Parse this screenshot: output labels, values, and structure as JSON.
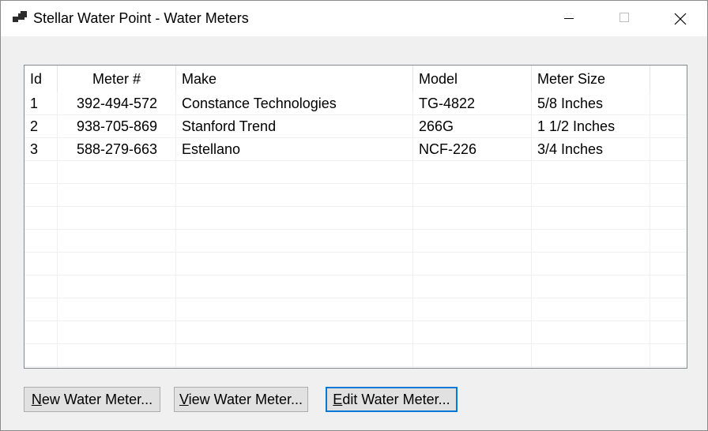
{
  "window": {
    "title": "Stellar Water Point - Water Meters",
    "icon": "app-window-icon"
  },
  "listview": {
    "columns": [
      {
        "key": "id",
        "label": "Id"
      },
      {
        "key": "meter",
        "label": "Meter #"
      },
      {
        "key": "make",
        "label": "Make"
      },
      {
        "key": "model",
        "label": "Model"
      },
      {
        "key": "size",
        "label": "Meter Size"
      }
    ],
    "rows": [
      {
        "id": "1",
        "meter": "392-494-572",
        "make": "Constance Technologies",
        "model": "TG-4822",
        "size": "5/8 Inches"
      },
      {
        "id": "2",
        "meter": "938-705-869",
        "make": "Stanford Trend",
        "model": "266G",
        "size": "1 1/2 Inches"
      },
      {
        "id": "3",
        "meter": "588-279-663",
        "make": "Estellano",
        "model": "NCF-226",
        "size": "3/4 Inches"
      }
    ]
  },
  "buttons": {
    "new": {
      "accel": "N",
      "rest": "ew Water Meter..."
    },
    "view": {
      "accel": "V",
      "rest": "iew Water Meter..."
    },
    "edit": {
      "accel": "E",
      "rest": "dit Water Meter..."
    }
  },
  "colors": {
    "focus_border": "#0078d7",
    "button_face": "#e1e1e1",
    "window_bg": "#f0f0f0"
  }
}
